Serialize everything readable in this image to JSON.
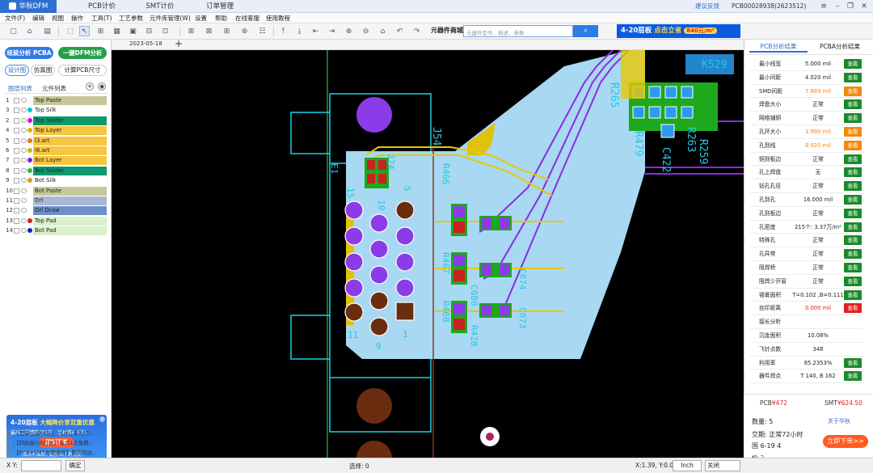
{
  "titlebar": {
    "app_tab": "华秋DFM",
    "tabs": [
      "PCB计价",
      "SMT计价",
      "订单管理"
    ],
    "feedback": "建议反馈",
    "user": "PCB00028938(2623512)"
  },
  "menu": [
    "文件(F)",
    "编辑",
    "视图",
    "操作",
    "工具(T)",
    "工艺参数",
    "元件库管理(W)",
    "设置",
    "帮助",
    "在线客服",
    "使用教程"
  ],
  "search": {
    "label": "元器件商城",
    "placeholder": "元器件型号、描述、参数"
  },
  "banner_top": {
    "left": "4-20层板",
    "highlight": "点击立省",
    "pill": "840元/m²"
  },
  "left": {
    "btn_analyze": "组装分析 PCBA",
    "btn_dfm": "一键DFM分析",
    "tab_design": "设计图",
    "tab_sim": "仿真图",
    "tab_calc": "计算PCB尺寸",
    "list_tab1": "图层列表",
    "list_tab2": "元件列表",
    "layers": [
      {
        "n": "1",
        "name": "Top Paste",
        "color": "#c7c79a",
        "dot": ""
      },
      {
        "n": "3",
        "name": "Top Silk",
        "color": "#ffffff",
        "dot": "#00c8e0"
      },
      {
        "n": "2",
        "name": "Top Solder",
        "color": "#0e9a6e",
        "dot": "#e000e0"
      },
      {
        "n": "4",
        "name": "Top Layer",
        "color": "#f6c640",
        "dot": "#e6b000"
      },
      {
        "n": "5",
        "name": "l3.art",
        "color": "#f6c640",
        "dot": "#e07a00"
      },
      {
        "n": "6",
        "name": "l6.art",
        "color": "#f6c640",
        "dot": "#d6b000"
      },
      {
        "n": "7",
        "name": "Bot Layer",
        "color": "#f6c640",
        "dot": "#7a20d0"
      },
      {
        "n": "8",
        "name": "Bot Solder",
        "color": "#0e9a6e",
        "dot": "#20c020"
      },
      {
        "n": "9",
        "name": "Bot Silk",
        "color": "#ffffff",
        "dot": "#f09020"
      },
      {
        "n": "10",
        "name": "Bot Paste",
        "color": "#c7c79a",
        "dot": ""
      },
      {
        "n": "11",
        "name": "Drl",
        "color": "#a9b8d6",
        "dot": ""
      },
      {
        "n": "12",
        "name": "Drl Draw",
        "color": "#6f8fc8",
        "dot": ""
      },
      {
        "n": "13",
        "name": "Top Pad",
        "color": "#d9f0c9",
        "dot": "#d02020"
      },
      {
        "n": "14",
        "name": "Bot Pad",
        "color": "#d9f0c9",
        "dot": "#1020d0"
      }
    ],
    "ad": {
      "line1": "4-20层板",
      "line1b": "大幅降价享",
      "line1c": "双重优惠",
      "line2": "最高工程费降至5折！板材费6.6折！",
      "btn": "即刻下单",
      "line3": "降价不降质，最快48小时交期"
    },
    "promos": [
      "【首单立减50元】PCB订单无门...",
      "【四层板0元打样】每月1次免费...",
      "【PCB+SMT大额返现】最高可达..."
    ]
  },
  "canvas": {
    "date": "2023-05-18",
    "labels": {
      "j54": "J54",
      "r479": "R479",
      "r259": "R259",
      "r263": "R263",
      "c422": "C422",
      "k529": "K529",
      "r265": "R265",
      "pin11": "11",
      "pin9": "9",
      "pin1": "1",
      "pin15": "15",
      "pin10": "10",
      "pin5": "5",
      "c080": "C080",
      "r467": "R467",
      "r468": "R468",
      "r466": "R466",
      "r428": "R428",
      "c074": "C074",
      "c073": "C073",
      "e1": "E1",
      "j24": "J24"
    }
  },
  "right": {
    "tab1": "PCB分析结果",
    "tab2": "PCBA分析结果",
    "rows": [
      {
        "k": "最小线宽",
        "v": "5.000 mil",
        "b": "查看",
        "vc": "",
        "bc": "green"
      },
      {
        "k": "最小间距",
        "v": "4.020 mil",
        "b": "查看",
        "vc": "",
        "bc": "green"
      },
      {
        "k": "SMD间距",
        "v": "7.869 mil",
        "b": "查看",
        "vc": "orange",
        "bc": "orange"
      },
      {
        "k": "焊盘大小",
        "v": "正常",
        "b": "查看",
        "vc": "",
        "bc": "green"
      },
      {
        "k": "网络铺铜",
        "v": "正常",
        "b": "查看",
        "vc": "",
        "bc": "green"
      },
      {
        "k": "孔环大小",
        "v": "3.990 mil",
        "b": "查看",
        "vc": "orange",
        "bc": "orange"
      },
      {
        "k": "孔到线",
        "v": "8.020 mil",
        "b": "查看",
        "vc": "orange",
        "bc": "orange"
      },
      {
        "k": "铜到板边",
        "v": "正常",
        "b": "查看",
        "vc": "",
        "bc": "green"
      },
      {
        "k": "孔上焊盘",
        "v": "无",
        "b": "查看",
        "vc": "",
        "bc": "green"
      },
      {
        "k": "钻孔孔径",
        "v": "正常",
        "b": "查看",
        "vc": "",
        "bc": "green"
      },
      {
        "k": "孔到孔",
        "v": "16.000 mil",
        "b": "查看",
        "vc": "",
        "bc": "green"
      },
      {
        "k": "孔到板边",
        "v": "正常",
        "b": "查看",
        "vc": "",
        "bc": "green"
      },
      {
        "k": "孔密度",
        "v": "215个: 3.37万/m²",
        "b": "查看",
        "vc": "",
        "bc": "green"
      },
      {
        "k": "特殊孔",
        "v": "正常",
        "b": "查看",
        "vc": "",
        "bc": "green"
      },
      {
        "k": "孔异常",
        "v": "正常",
        "b": "查看",
        "vc": "",
        "bc": "green"
      },
      {
        "k": "阻焊桥",
        "v": "正常",
        "b": "查看",
        "vc": "",
        "bc": "green"
      },
      {
        "k": "阻焊少开窗",
        "v": "正常",
        "b": "查看",
        "vc": "",
        "bc": "green"
      },
      {
        "k": "锡膏面积",
        "v": "T=0.102 ,B=0.111",
        "b": "查看",
        "vc": "",
        "bc": "green"
      },
      {
        "k": "丝印距离",
        "v": "0.000 mil",
        "b": "查看",
        "vc": "red",
        "bc": "red"
      },
      {
        "k": "接长分析",
        "v": "",
        "b": "",
        "vc": "",
        "bc": ""
      },
      {
        "k": "沉金面积",
        "v": "10.08%",
        "b": "",
        "vc": "",
        "bc": ""
      },
      {
        "k": "飞针点数",
        "v": "348",
        "b": "",
        "vc": "",
        "bc": ""
      },
      {
        "k": "利用率",
        "v": "85.2353%",
        "b": "查看",
        "vc": "",
        "bc": "green"
      },
      {
        "k": "器件焊点",
        "v": "T 140, B 162",
        "b": "查看",
        "vc": "",
        "bc": "green"
      }
    ],
    "quote": {
      "pcb_label": "PCB",
      "pcb_price": "¥472",
      "smt_label": "SMT",
      "smt_price": "¥624.50",
      "qty_label": "数量:",
      "qty": "5",
      "about": "关于华秋",
      "delivery_label": "交期:",
      "delivery": "正常72小时",
      "date_label": "国",
      "date": "6-19 4",
      "price_label": "价",
      "price_val": "2",
      "order_btn": "立即下单>>"
    }
  },
  "status": {
    "xy_label": "X Y:",
    "confirm": "确定",
    "select": "选择: 0",
    "coords": "X:1.39, Y:0.09",
    "unit": "Inch",
    "mode": "关闭"
  }
}
